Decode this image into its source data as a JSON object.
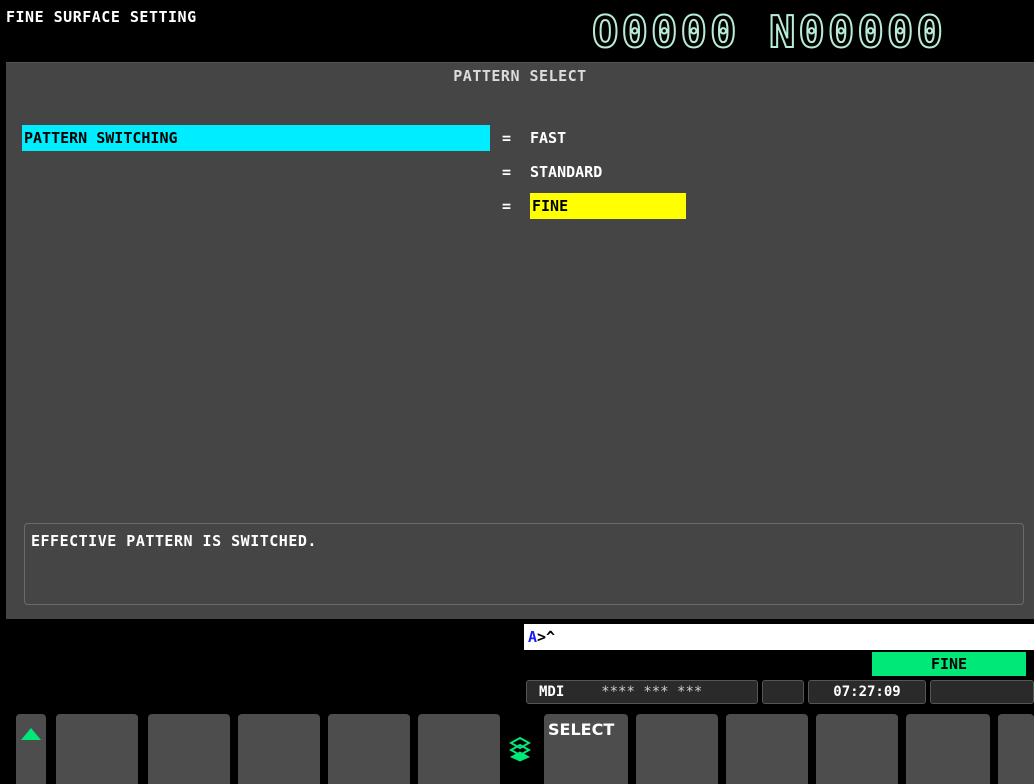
{
  "title_bar": {
    "screen_title": "FINE SURFACE SETTING",
    "program_number": "O0000 N00000"
  },
  "main": {
    "section_title": "PATTERN SELECT",
    "setting_label": "PATTERN SWITCHING",
    "options": [
      {
        "eq": "=",
        "label": "FAST",
        "selected": false
      },
      {
        "eq": "=",
        "label": "STANDARD",
        "selected": false
      },
      {
        "eq": "=",
        "label": "FINE",
        "selected": true
      }
    ],
    "message": "EFFECTIVE PATTERN IS SWITCHED."
  },
  "input_line": {
    "prefix": "A",
    "text": ">^"
  },
  "status": {
    "mode_indicator": "FINE",
    "mode": "MDI",
    "stars": "**** *** ***",
    "clock": "07:27:09"
  },
  "softkeys": {
    "select_label": "SELECT"
  },
  "icons": {
    "prev_arrow": "triangle-up-icon",
    "extend": "layers-icon"
  },
  "colors": {
    "highlight_label": "#00ecff",
    "highlight_selected": "#ffff00",
    "mode_green": "#00e878",
    "panel_gray": "#454545"
  }
}
